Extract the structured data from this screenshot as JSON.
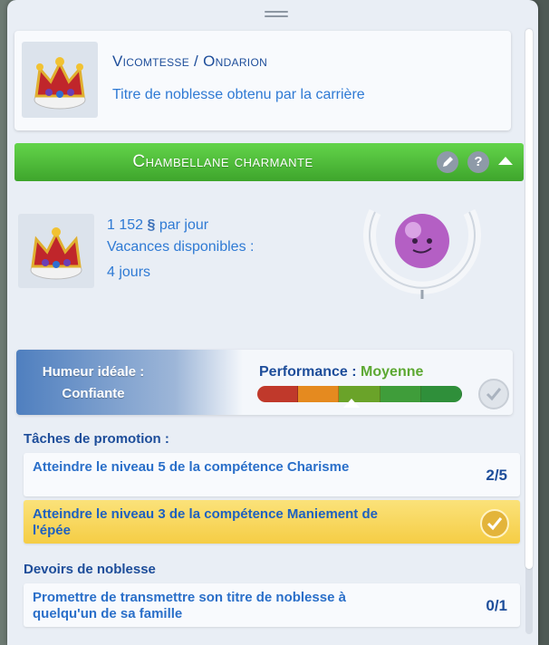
{
  "rank": {
    "title": "Vicomtesse / Ondarion",
    "subtitle": "Titre de noblesse obtenu par la carrière",
    "icon": "crown-icon"
  },
  "career": {
    "title": "Chambellane charmante",
    "edit_icon": "pencil-icon",
    "help_label": "?",
    "collapse_icon": "chevron-up-icon",
    "pay_amount": "1 152",
    "currency_symbol": "§",
    "pay_suffix": "par jour",
    "vacation_label": "Vacances disponibles :",
    "vacation_value": "4 jours"
  },
  "performance": {
    "mood_label": "Humeur idéale :",
    "mood_value": "Confiante",
    "label": "Performance :",
    "value": "Moyenne",
    "level_fraction": 0.46,
    "segment_colors": [
      "#c0392b",
      "#e58a1f",
      "#6aa329",
      "#3f9d3a",
      "#2f8f3a"
    ]
  },
  "promotion": {
    "heading": "Tâches de promotion :",
    "tasks": [
      {
        "text": "Atteindre le niveau 5  de la compétence Charisme",
        "progress": "2/5",
        "done": false
      },
      {
        "text": "Atteindre le niveau  3 de la compétence Maniement de l'épée",
        "progress": "",
        "done": true
      }
    ]
  },
  "duties": {
    "heading": "Devoirs de noblesse",
    "tasks": [
      {
        "text": "Promettre de transmettre son titre de noblesse à quelqu'un de sa famille",
        "progress": "0/1"
      }
    ]
  },
  "colors": {
    "accent_green": "#4cbd34",
    "text_blue": "#1d4d9a",
    "highlight_gold": "#f5cd45"
  }
}
